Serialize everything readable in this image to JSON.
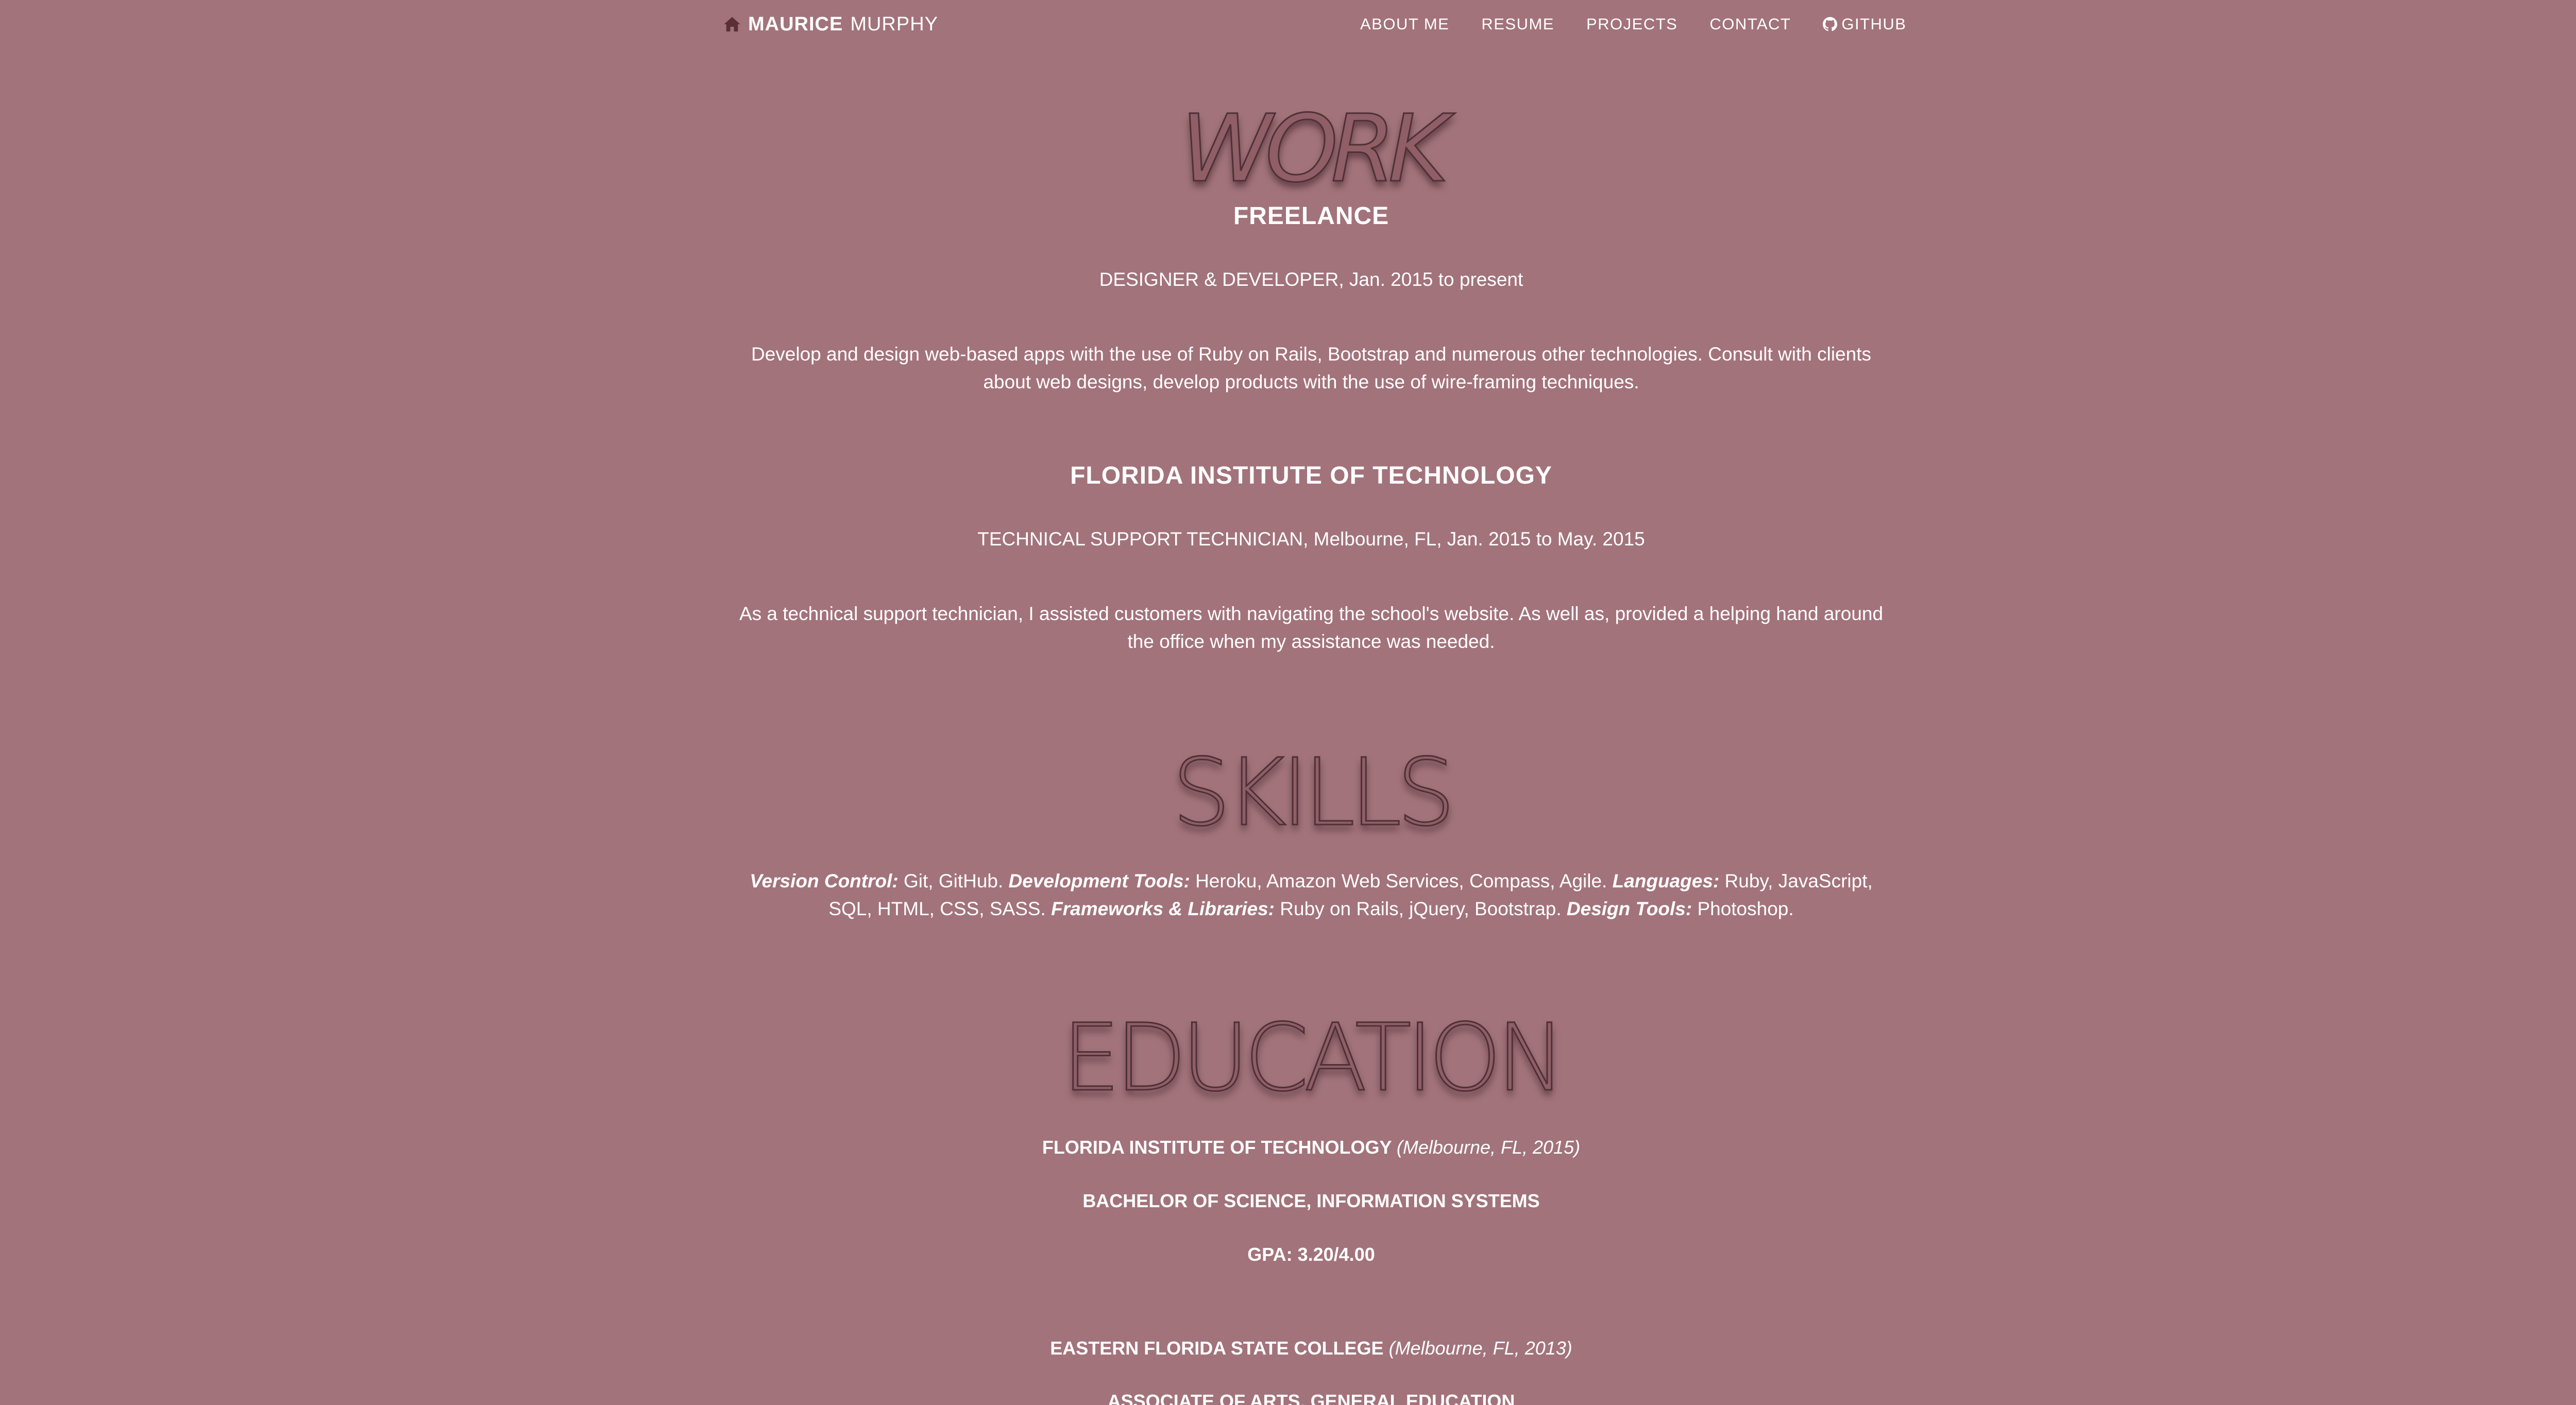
{
  "nav": {
    "brand_first": "MAURICE",
    "brand_last": "MURPHY",
    "links": [
      "ABOUT ME",
      "RESUME",
      "PROJECTS",
      "CONTACT",
      "GITHUB"
    ]
  },
  "sections": {
    "work_title": "WORK",
    "skills_title": "SKILLS",
    "education_title": "EDUCATION"
  },
  "work": [
    {
      "employer": "FREELANCE",
      "role": "DESIGNER & DEVELOPER, Jan. 2015 to present",
      "description": "Develop and design web-based apps with the use of Ruby on Rails, Bootstrap and numerous other technologies. Consult with clients about web designs, develop products with the use of wire-framing techniques."
    },
    {
      "employer": "FLORIDA INSTITUTE OF TECHNOLOGY",
      "role": "TECHNICAL SUPPORT TECHNICIAN, Melbourne, FL, Jan. 2015 to May. 2015",
      "description": "As a technical support technician, I assisted customers with navigating the school's website. As well as, provided a helping hand around the office when my assistance was needed."
    }
  ],
  "skills": [
    {
      "category": "Version Control:",
      "items": "Git, GitHub."
    },
    {
      "category": "Development Tools:",
      "items": "Heroku, Amazon Web Services, Compass, Agile."
    },
    {
      "category": "Languages:",
      "items": "Ruby, JavaScript, SQL, HTML, CSS, SASS."
    },
    {
      "category": "Frameworks & Libraries:",
      "items": "Ruby on Rails, jQuery, Bootstrap."
    },
    {
      "category": "Design Tools:",
      "items": "Photoshop."
    }
  ],
  "education": [
    {
      "school": "FLORIDA INSTITUTE OF TECHNOLOGY",
      "location": "(Melbourne, FL, 2015)",
      "degree": "BACHELOR OF SCIENCE, INFORMATION SYSTEMS",
      "gpa": "GPA: 3.20/4.00"
    },
    {
      "school": "EASTERN FLORIDA STATE COLLEGE",
      "location": "(Melbourne, FL, 2013)",
      "degree": "ASSOCIATE OF ARTS, GENERAL EDUCATION"
    }
  ],
  "colors": {
    "background": "#a2737b",
    "title_fill": "#8f5e67",
    "title_stroke": "#4e3036",
    "text": "#ffffff"
  }
}
